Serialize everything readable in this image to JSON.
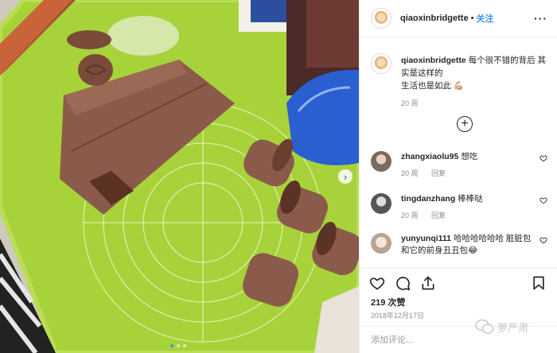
{
  "post": {
    "username": "qiaoxinbridgette",
    "follow_label": "关注",
    "more_icon": "more-icon"
  },
  "caption": {
    "text_line1": "每个很不错的背后 其",
    "text_line2": "实是这样的",
    "text_line3": "生活也是如此 💪🏼",
    "age": "20 周"
  },
  "comments": [
    {
      "username": "zhangxiaolu95",
      "text": "想吃",
      "age": "20 周",
      "reply": "回复"
    },
    {
      "username": "tingdanzhang",
      "text": "棒棒哒",
      "age": "20 周",
      "reply": "回复"
    },
    {
      "username": "yunyunqi111",
      "text": "哈哈哈哈哈哈 脏脏包和它的前身丑丑包😂",
      "age": "",
      "reply": ""
    }
  ],
  "stats": {
    "likes": "219 次赞",
    "date": "2018年12月17日"
  },
  "input": {
    "placeholder": "添加评论..."
  },
  "watermark": {
    "text": "萝严肃"
  },
  "colors": {
    "accent": "#3897f0",
    "mat": "#a8d23a"
  }
}
